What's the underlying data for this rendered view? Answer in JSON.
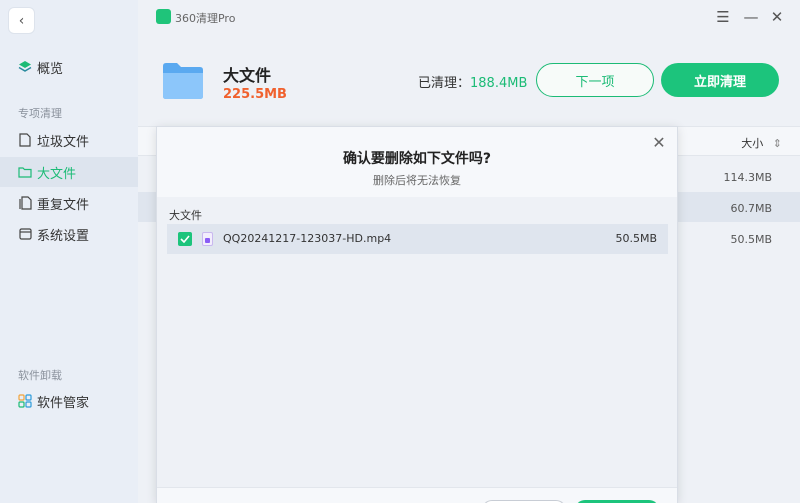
{
  "app": {
    "name": "360清理Pro"
  },
  "sidebar": {
    "overview": "概览",
    "section_special": "专项清理",
    "items": [
      {
        "label": "垃圾文件"
      },
      {
        "label": "大文件"
      },
      {
        "label": "重复文件"
      },
      {
        "label": "系统设置"
      }
    ],
    "section_software": "软件卸载",
    "software_manager": "软件管家"
  },
  "header": {
    "title": "大文件",
    "size": "225.5MB",
    "cleaned_label": "已清理：",
    "cleaned_value": "188.4MB",
    "next_button": "下一项",
    "clean_button": "立即清理"
  },
  "list": {
    "column_size": "大小",
    "rows": [
      {
        "size": "114.3MB"
      },
      {
        "size": "60.7MB"
      },
      {
        "size": "50.5MB"
      }
    ]
  },
  "dialog": {
    "title": "确认要删除如下文件吗?",
    "subtitle": "删除后将无法恢复",
    "group_label": "大文件",
    "file": {
      "name": "QQ20241217-123037-HD.mp4",
      "size": "50.5MB",
      "checked": true
    }
  },
  "colors": {
    "accent": "#1cc47c",
    "size_highlight": "#f0612e"
  }
}
